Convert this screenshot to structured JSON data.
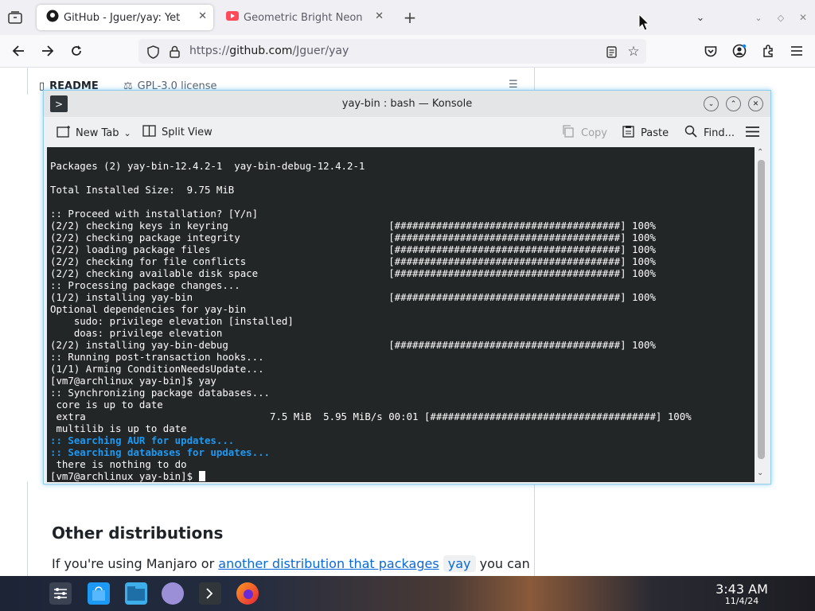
{
  "browser": {
    "tabs": [
      {
        "title": "GitHub - Jguer/yay: Yet an"
      },
      {
        "title": "Geometric Bright Neon Tr"
      }
    ],
    "url_prefix": "https://",
    "url_domain": "github.com",
    "url_path": "/Jguer/yay"
  },
  "page": {
    "readme_tab": "README",
    "license_tab": "GPL-3.0 license",
    "heading": "Other distributions",
    "para_start": "If you're using Manjaro or",
    "para_link": "another distribution that packages",
    "para_code": "yay",
    "para_end": "you can"
  },
  "konsole": {
    "title": "yay-bin : bash — Konsole",
    "toolbar": {
      "new_tab": "New Tab",
      "split_view": "Split View",
      "copy": "Copy",
      "paste": "Paste",
      "find": "Find..."
    },
    "lines": [
      "Packages (2) yay-bin-12.4.2-1  yay-bin-debug-12.4.2-1",
      "",
      "Total Installed Size:  9.75 MiB",
      "",
      ":: Proceed with installation? [Y/n]",
      "(2/2) checking keys in keyring                           [######################################] 100%",
      "(2/2) checking package integrity                         [######################################] 100%",
      "(2/2) loading package files                              [######################################] 100%",
      "(2/2) checking for file conflicts                        [######################################] 100%",
      "(2/2) checking available disk space                      [######################################] 100%",
      ":: Processing package changes...",
      "(1/2) installing yay-bin                                 [######################################] 100%",
      "Optional dependencies for yay-bin",
      "    sudo: privilege elevation [installed]",
      "    doas: privilege elevation",
      "(2/2) installing yay-bin-debug                           [######################################] 100%",
      ":: Running post-transaction hooks...",
      "(1/1) Arming ConditionNeedsUpdate...",
      "[vm7@archlinux yay-bin]$ yay",
      ":: Synchronizing package databases...",
      " core is up to date",
      " extra                               7.5 MiB  5.95 MiB/s 00:01 [######################################] 100%",
      " multilib is up to date"
    ],
    "blue_lines": [
      {
        "prefix": ":: ",
        "text": "Searching AUR for updates..."
      },
      {
        "prefix": ":: ",
        "text": "Searching databases for updates..."
      }
    ],
    "after_lines": [
      " there is nothing to do"
    ],
    "prompt": "[vm7@archlinux yay-bin]$ "
  },
  "taskbar": {
    "time": "3:43 AM",
    "date": "11/4/24"
  },
  "colors": {
    "terminal_bg": "#232627",
    "terminal_fg": "#fcfcfc",
    "terminal_blue": "#1d99f3",
    "link": "#0969da",
    "konsole_border": "#93cee9"
  },
  "icons": [
    "firefox-view-icon",
    "github-icon",
    "youtube-icon",
    "back-icon",
    "forward-icon",
    "reload-icon",
    "shield-icon",
    "lock-icon",
    "reader-icon",
    "star-icon",
    "pocket-icon",
    "account-icon",
    "extensions-icon",
    "menu-icon",
    "konsole-icon",
    "new-tab-icon",
    "split-view-icon",
    "copy-icon",
    "paste-icon",
    "find-icon",
    "hamburger-icon"
  ]
}
